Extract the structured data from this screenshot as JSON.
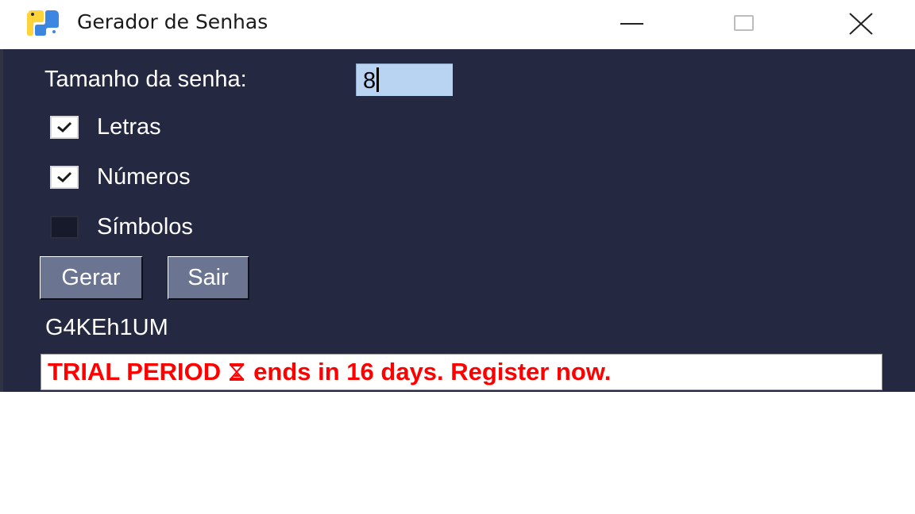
{
  "window": {
    "title": "Gerador de Senhas",
    "icon": "python-icon",
    "controls": [
      "minimize-icon",
      "maximize-icon",
      "close-icon"
    ]
  },
  "form": {
    "size_label": "Tamanho da senha:",
    "size_value": "8",
    "options": [
      {
        "label": "Letras",
        "checked": true
      },
      {
        "label": "Números",
        "checked": true
      },
      {
        "label": "Símbolos",
        "checked": false
      }
    ]
  },
  "buttons": {
    "generate": "Gerar",
    "exit": "Sair"
  },
  "result": {
    "password": "G4KEh1UM"
  },
  "trial_banner": {
    "text_before": "TRIAL PERIOD",
    "icon": "hourglass-icon",
    "text_after": "ends in 16 days. Register now."
  },
  "colors": {
    "background": "#242840",
    "button": "#6b7592",
    "input": "#b8d4f2",
    "banner_text": "#ff0000"
  }
}
